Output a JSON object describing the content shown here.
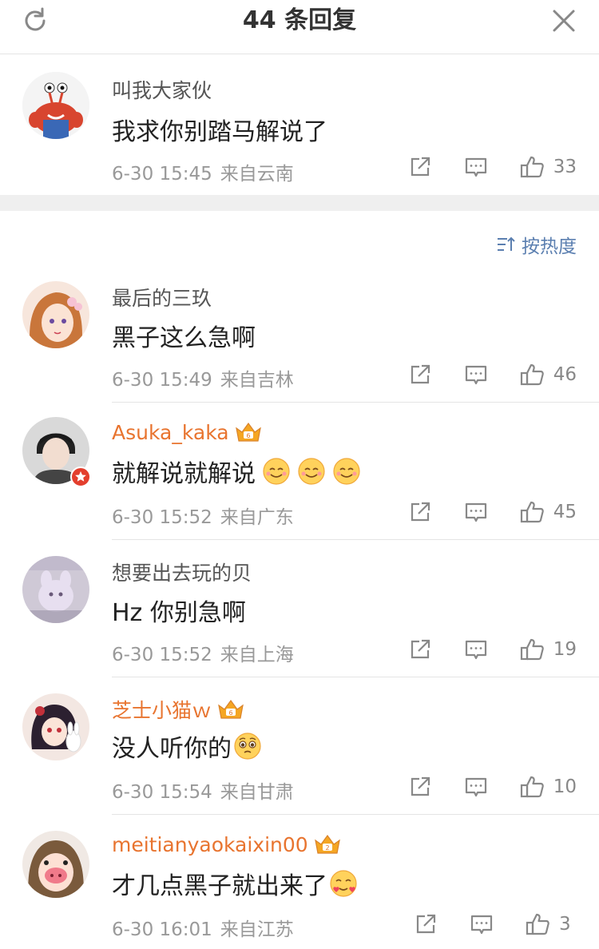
{
  "header": {
    "title": "44 条回复",
    "refresh_icon": "refresh-icon",
    "close_icon": "close-icon"
  },
  "main_comment": {
    "username": "叫我大家伙",
    "text": "我求你别踏马解说了",
    "date": "6-30 15:45",
    "location": "来自云南",
    "likes": "33"
  },
  "sort": {
    "label": "按热度",
    "icon": "sort-icon"
  },
  "colors": {
    "vip_name": "#e8742f",
    "link_blue": "#5b7fb0",
    "gap_gray": "#efefef"
  },
  "replies": [
    {
      "username": "最后的三玖",
      "vip": false,
      "text": "黑子这么急啊",
      "emojis": [],
      "date": "6-30 15:49",
      "location": "来自吉林",
      "likes": "46"
    },
    {
      "username": "Asuka_kaka",
      "vip": true,
      "text": "就解说就解说",
      "emojis": [
        "smile-emoji",
        "smile-emoji",
        "smile-emoji"
      ],
      "date": "6-30 15:52",
      "location": "来自广东",
      "likes": "45"
    },
    {
      "username": "想要出去玩的贝",
      "vip": false,
      "text": "Hz 你别急啊",
      "emojis": [],
      "date": "6-30 15:52",
      "location": "来自上海",
      "likes": "19"
    },
    {
      "username": "芝士小猫ｗ",
      "vip": true,
      "text": "没人听你的",
      "emojis": [
        "pleading-emoji"
      ],
      "date": "6-30 15:54",
      "location": "来自甘肃",
      "likes": "10"
    },
    {
      "username": "meitianyaokaixin00",
      "vip": true,
      "text": "才几点黑子就出来了",
      "emojis": [
        "love-emoji"
      ],
      "date": "6-30 16:01",
      "location": "来自江苏",
      "likes": "3"
    }
  ]
}
